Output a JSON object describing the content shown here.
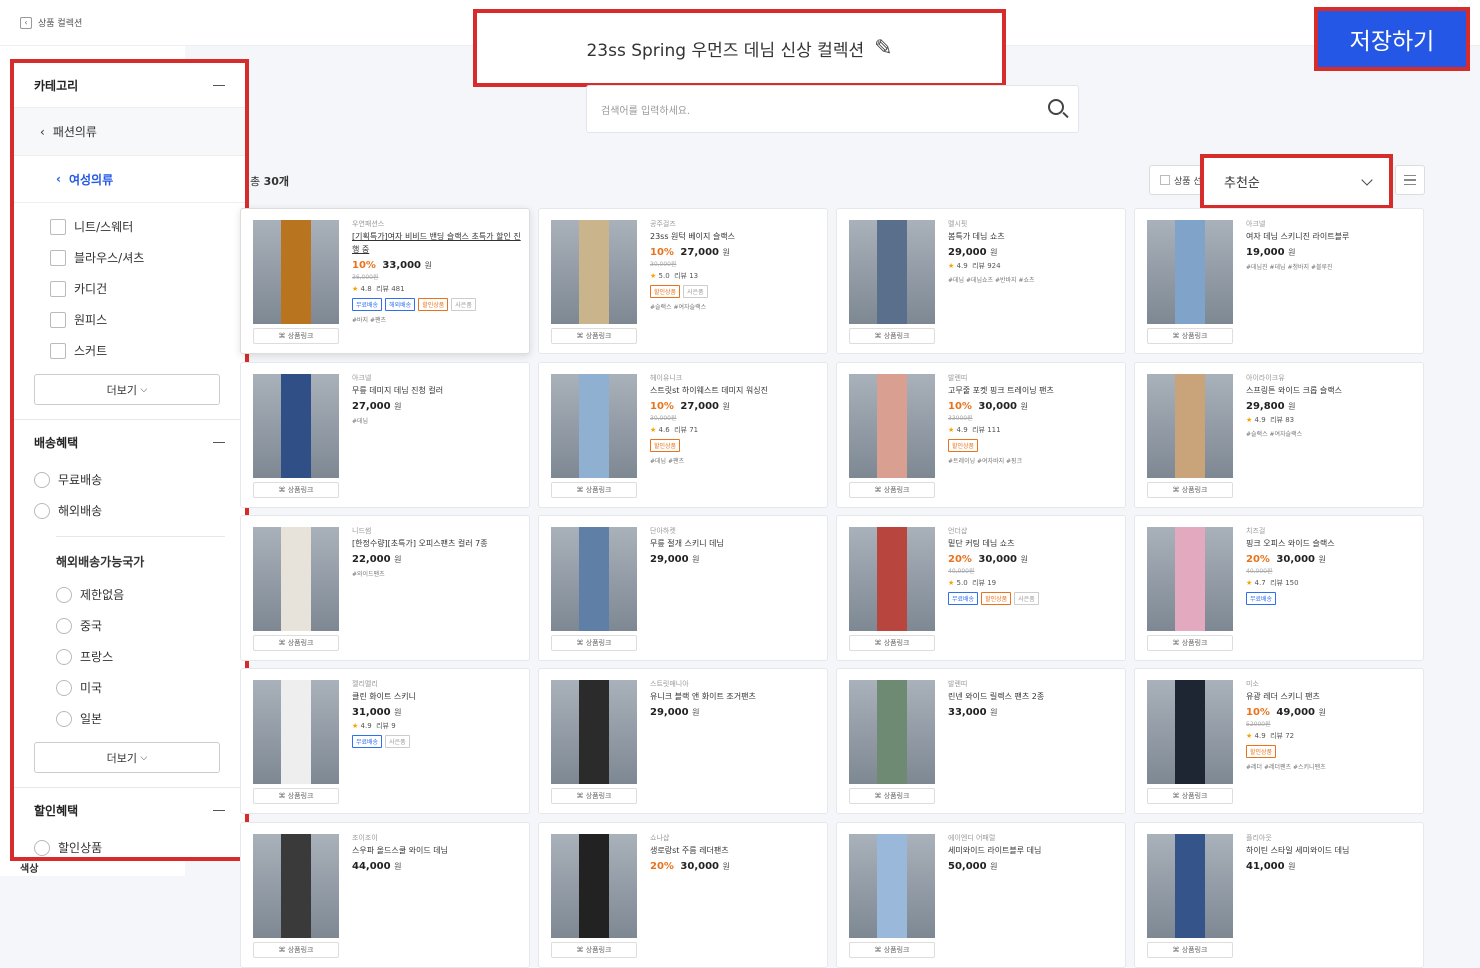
{
  "header": {
    "back_label": "상품 컬렉션",
    "collection_title": "23ss Spring 우먼즈 데님 신상 컬렉션",
    "save_label": "저장하기"
  },
  "search": {
    "placeholder": "검색어를 입력하세요."
  },
  "toolbar": {
    "count_prefix": "총",
    "count": "30개",
    "select_all": "상품 선",
    "sort_value": "추천순"
  },
  "sidebar": {
    "category_title": "카테고리",
    "crumb_1": "패션의류",
    "crumb_2": "여성의류",
    "categories": [
      "니트/스웨터",
      "블라우스/셔츠",
      "카디건",
      "원피스",
      "스커트"
    ],
    "more_label": "더보기",
    "shipping_title": "배송혜택",
    "shipping_options": [
      "무료배송",
      "해외배송"
    ],
    "country_title": "해외배송가능국가",
    "countries": [
      "제한없음",
      "중국",
      "프랑스",
      "미국",
      "일본"
    ],
    "discount_title": "할인혜택",
    "discount_options": [
      "할인상품"
    ],
    "color_title": "색상"
  },
  "link_label": "상품링크",
  "products": [
    {
      "brand": "우연패션스",
      "name": "[기획특가]여자 비비드 밴딩 슬랙스 초특가 할인 진행 중",
      "discount": "10%",
      "price": "33,000",
      "won": "원",
      "orig": "36,000원",
      "rating": "4.8",
      "reviews": "리뷰 481",
      "tags": [
        "무료배송",
        "해외배송",
        "할인상품",
        "사은품"
      ],
      "hash": "#바지 #팬츠",
      "color": "#b8741f"
    },
    {
      "brand": "공주걸즈",
      "name": "23ss 원턱 베이지 슬랙스",
      "discount": "10%",
      "price": "27,000",
      "won": "원",
      "orig": "30,000원",
      "rating": "5.0",
      "reviews": "리뷰 13",
      "tags": [
        "할인상품",
        "사은품"
      ],
      "hash": "#슬랙스 #여자슬랙스",
      "color": "#c9b48c"
    },
    {
      "brand": "멜시핏",
      "name": "봄특가 데님 쇼츠",
      "discount": "",
      "price": "29,000",
      "won": "원",
      "orig": "",
      "rating": "4.9",
      "reviews": "리뷰 924",
      "tags": [],
      "hash": "#데님 #데님쇼츠 #반바지 #쇼츠",
      "color": "#5a6f8c"
    },
    {
      "brand": "아크넬",
      "name": "여자 데님 스키니진 라이트블루",
      "discount": "",
      "price": "19,000",
      "won": "원",
      "orig": "",
      "rating": "",
      "reviews": "",
      "tags": [],
      "hash": "#데님진 #데님 #청바지 #블루진",
      "color": "#7fa3c9"
    },
    {
      "brand": "아크넬",
      "name": "무릎 데미지 데님 진청 컬러",
      "discount": "",
      "price": "27,000",
      "won": "원",
      "orig": "",
      "rating": "",
      "reviews": "",
      "tags": [],
      "hash": "#데님",
      "color": "#2f4f86"
    },
    {
      "brand": "헤이유니크",
      "name": "스트릿st 하이웨스트 데미지 워싱진",
      "discount": "10%",
      "price": "27,000",
      "won": "원",
      "orig": "30,000원",
      "rating": "4.6",
      "reviews": "리뷰 71",
      "tags": [
        "할인상품"
      ],
      "hash": "#데님 #팬츠",
      "color": "#8fb0d0"
    },
    {
      "brand": "발렌띠",
      "name": "고무줄 포켓 핑크 트레이닝 팬츠",
      "discount": "10%",
      "price": "30,000",
      "won": "원",
      "orig": "33000원",
      "rating": "4.9",
      "reviews": "리뷰 111",
      "tags": [
        "할인상품"
      ],
      "hash": "#트레이닝 #여자바지 #핑크",
      "color": "#d9a091"
    },
    {
      "brand": "아이라이크유",
      "name": "스프링튼 와이드 크롭 슬랙스",
      "discount": "",
      "price": "29,800",
      "won": "원",
      "orig": "",
      "rating": "4.9",
      "reviews": "리뷰 83",
      "tags": [],
      "hash": "#슬랙스 #여자슬랙스",
      "color": "#c9a37a"
    },
    {
      "brand": "니드썸",
      "name": "[한정수량][초특가] 오피스팬츠 컬러 7종",
      "discount": "",
      "price": "22,000",
      "won": "원",
      "orig": "",
      "rating": "",
      "reviews": "",
      "tags": [],
      "hash": "#와이드팬츠",
      "color": "#e8e3da"
    },
    {
      "brand": "단아하켓",
      "name": "무릎 절개 스키니 데님",
      "discount": "",
      "price": "29,000",
      "won": "원",
      "orig": "",
      "rating": "",
      "reviews": "",
      "tags": [],
      "hash": "",
      "color": "#5f7fa6"
    },
    {
      "brand": "언더샵",
      "name": "밑단 커팅 데님 쇼츠",
      "discount": "20%",
      "price": "30,000",
      "won": "원",
      "orig": "40,000원",
      "rating": "5.0",
      "reviews": "리뷰 19",
      "tags": [
        "무료배송",
        "할인상품",
        "사은품"
      ],
      "hash": "",
      "color": "#b9463e"
    },
    {
      "brand": "치즈걸",
      "name": "핑크 오피스 와이드 슬랙스",
      "discount": "20%",
      "price": "30,000",
      "won": "원",
      "orig": "40,000원",
      "rating": "4.7",
      "reviews": "리뷰 150",
      "tags": [
        "무료배송"
      ],
      "hash": "",
      "color": "#e3a9bf"
    },
    {
      "brand": "젤리멜리",
      "name": "클린 화이트 스키니",
      "discount": "",
      "price": "31,000",
      "won": "원",
      "orig": "",
      "rating": "4.9",
      "reviews": "리뷰 9",
      "tags": [
        "무료배송",
        "사은품"
      ],
      "hash": "",
      "color": "#eeeeee"
    },
    {
      "brand": "스트릿매니아",
      "name": "유니크 블랙 앤 화이트 조거팬츠",
      "discount": "",
      "price": "29,000",
      "won": "원",
      "orig": "",
      "rating": "",
      "reviews": "",
      "tags": [],
      "hash": "",
      "color": "#2b2b2b"
    },
    {
      "brand": "발렌띠",
      "name": "린넨 와이드 릴렉스 팬츠 2종",
      "discount": "",
      "price": "33,000",
      "won": "원",
      "orig": "",
      "rating": "",
      "reviews": "",
      "tags": [],
      "hash": "",
      "color": "#6f8a72"
    },
    {
      "brand": "미소",
      "name": "유광 레더 스키니 팬츠",
      "discount": "10%",
      "price": "49,000",
      "won": "원",
      "orig": "52000원",
      "rating": "4.9",
      "reviews": "리뷰 72",
      "tags": [
        "할인상품"
      ],
      "hash": "#레더 #레더팬츠 #스키니팬츠",
      "color": "#1e2633"
    },
    {
      "brand": "조이조이",
      "name": "스우파 올드스쿨 와이드 데님",
      "discount": "",
      "price": "44,000",
      "won": "원",
      "orig": "",
      "rating": "",
      "reviews": "",
      "tags": [],
      "hash": "",
      "color": "#3a3a3a"
    },
    {
      "brand": "쇼나샵",
      "name": "생로랑st 주름 레더팬츠",
      "discount": "20%",
      "price": "30,000",
      "won": "원",
      "orig": "",
      "rating": "",
      "reviews": "",
      "tags": [],
      "hash": "",
      "color": "#222222"
    },
    {
      "brand": "에이엔디 어패럴",
      "name": "세미와이드 라이트블루 데님",
      "discount": "",
      "price": "50,000",
      "won": "원",
      "orig": "",
      "rating": "",
      "reviews": "",
      "tags": [],
      "hash": "",
      "color": "#9ab8d9"
    },
    {
      "brand": "플리아웃",
      "name": "하이틴 스타일 세미와이드 데님",
      "discount": "",
      "price": "41,000",
      "won": "원",
      "orig": "",
      "rating": "",
      "reviews": "",
      "tags": [],
      "hash": "",
      "color": "#34548a"
    }
  ]
}
